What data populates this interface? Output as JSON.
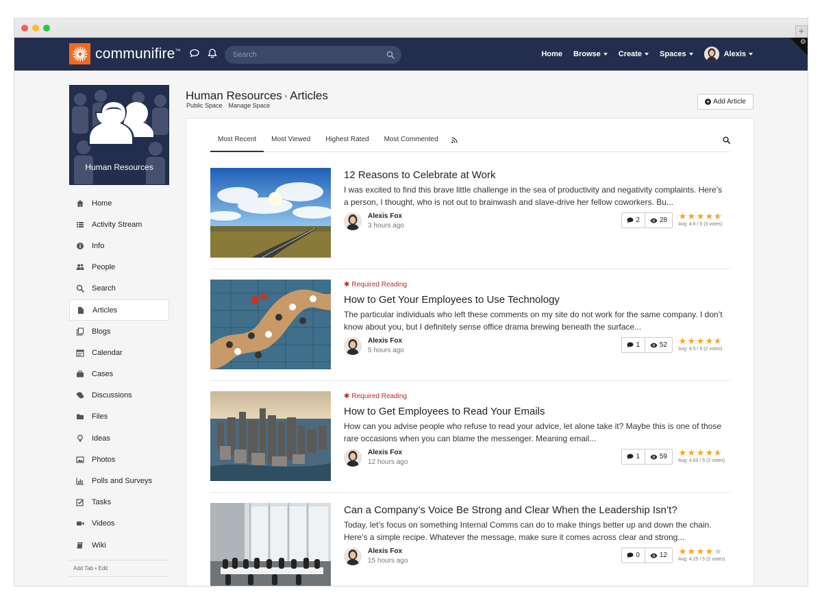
{
  "nav": {
    "brand": "communifire",
    "brand_tm": "™",
    "search_placeholder": "Search",
    "menu": [
      {
        "label": "Home",
        "caret": false
      },
      {
        "label": "Browse",
        "caret": true
      },
      {
        "label": "Create",
        "caret": true
      },
      {
        "label": "Spaces",
        "caret": true
      }
    ],
    "user": "Alexis"
  },
  "space": {
    "name": "Human Resources"
  },
  "sidebar": {
    "items": [
      {
        "label": "Home",
        "icon": "home-icon"
      },
      {
        "label": "Activity Stream",
        "icon": "list-icon"
      },
      {
        "label": "Info",
        "icon": "info-icon"
      },
      {
        "label": "People",
        "icon": "people-icon"
      },
      {
        "label": "Search",
        "icon": "search-icon"
      },
      {
        "label": "Articles",
        "icon": "file-icon"
      },
      {
        "label": "Blogs",
        "icon": "blog-icon"
      },
      {
        "label": "Calendar",
        "icon": "calendar-icon"
      },
      {
        "label": "Cases",
        "icon": "briefcase-icon"
      },
      {
        "label": "Discussions",
        "icon": "comments-icon"
      },
      {
        "label": "Files",
        "icon": "folder-icon"
      },
      {
        "label": "Ideas",
        "icon": "lightbulb-icon"
      },
      {
        "label": "Photos",
        "icon": "photo-icon"
      },
      {
        "label": "Polls and Surveys",
        "icon": "bar-chart-icon"
      },
      {
        "label": "Tasks",
        "icon": "checkbox-icon"
      },
      {
        "label": "Videos",
        "icon": "video-icon"
      },
      {
        "label": "Wiki",
        "icon": "book-icon"
      }
    ],
    "active_index": 5,
    "footer_add": "Add Tab",
    "footer_sep": "•",
    "footer_edit": "Edit"
  },
  "header": {
    "breadcrumb_space": "Human Resources",
    "breadcrumb_sep": "›",
    "breadcrumb_page": "Articles",
    "sub_public": "Public Space",
    "sub_sep": "·",
    "sub_manage": "Manage Space",
    "add_button": "Add Article"
  },
  "tabs": [
    "Most Recent",
    "Most Viewed",
    "Highest Rated",
    "Most Commented"
  ],
  "required_label": "Required Reading",
  "articles": [
    {
      "required": false,
      "title": "12 Reasons to Celebrate at Work",
      "excerpt": "I was excited to find this brave little challenge in the sea of productivity and negativity complaints. Here’s a person, I thought, who is not out to brainwash and slave-drive her fellow coworkers. Bu...",
      "author": "Alexis Fox",
      "time": "3 hours ago",
      "comments": "2",
      "views": "28",
      "rating": 4.6,
      "avg": "Avg: 4.6 / 5 (3 votes)"
    },
    {
      "required": true,
      "title": "How to Get Your Employees to Use Technology",
      "excerpt": "The particular individuals who left these comments on my site do not work for the same company. I don’t know about you, but I definitely sense office drama brewing beneath the surface...",
      "author": "Alexis Fox",
      "time": "5 hours ago",
      "comments": "1",
      "views": "52",
      "rating": 4.5,
      "avg": "Avg: 4.5 / 5 (2 votes)"
    },
    {
      "required": true,
      "title": "How to Get Employees to Read Your Emails",
      "excerpt": "How can you advise people who refuse to read your advice, let alone take it? Maybe this is one of those rare occasions when you can blame the messenger. Meaning email...",
      "author": "Alexis Fox",
      "time": "12 hours ago",
      "comments": "1",
      "views": "59",
      "rating": 4.63,
      "avg": "Avg: 4.63 / 5 (2 votes)"
    },
    {
      "required": false,
      "title": "Can a Company’s Voice Be Strong and Clear When the Leadership Isn’t?",
      "excerpt": "Today, let’s focus on something Internal Comms can do to make things better up and down the chain. Here’s a simple recipe. Whatever the message, make sure it comes across clear and strong...",
      "author": "Alexis Fox",
      "time": "15 hours ago",
      "comments": "0",
      "views": "12",
      "rating": 4.25,
      "avg": "Avg: 4.25 / 5 (2 votes)"
    }
  ],
  "colors": {
    "nav_bg": "#232e4e",
    "brand_orange": "#f26a21",
    "star": "#f5a623",
    "required": "#b5292e"
  }
}
